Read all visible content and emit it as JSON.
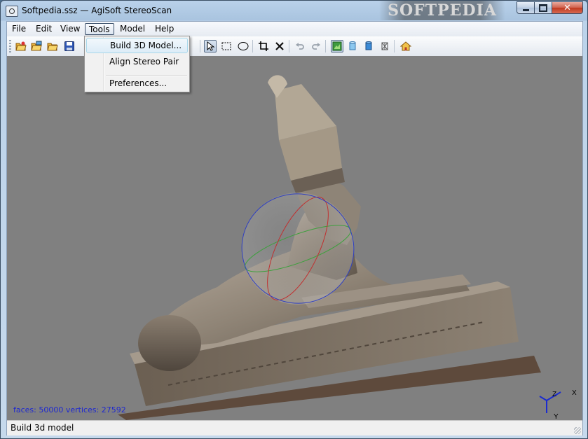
{
  "window": {
    "title": "Softpedia.ssz — AgiSoft StereoScan",
    "watermark": "SOFTPEDIA"
  },
  "menu": {
    "items": [
      {
        "label": "File"
      },
      {
        "label": "Edit"
      },
      {
        "label": "View"
      },
      {
        "label": "Tools",
        "active": true
      },
      {
        "label": "Model"
      },
      {
        "label": "Help"
      }
    ]
  },
  "tools_menu": {
    "items": [
      {
        "label": "Build 3D Model...",
        "highlighted": true
      },
      {
        "label": "Align Stereo Pair"
      },
      {
        "label": "Preferences..."
      }
    ]
  },
  "toolbar": {
    "buttons": [
      {
        "icon": "open-project-icon"
      },
      {
        "icon": "open-images-icon"
      },
      {
        "icon": "open-folder-icon"
      },
      {
        "icon": "save-icon"
      },
      {
        "icon": "select-pointer-icon",
        "pressed": true
      },
      {
        "icon": "rectangle-selection-icon"
      },
      {
        "icon": "ellipse-selection-icon"
      },
      {
        "icon": "crop-icon"
      },
      {
        "icon": "delete-icon"
      },
      {
        "icon": "undo-icon"
      },
      {
        "icon": "redo-icon"
      },
      {
        "icon": "textured-view-icon",
        "pressed": true
      },
      {
        "icon": "solid-view-icon"
      },
      {
        "icon": "shaded-view-icon"
      },
      {
        "icon": "wireframe-view-icon"
      },
      {
        "icon": "home-view-icon"
      }
    ]
  },
  "viewport": {
    "stats": "faces: 50000 vertices: 27592",
    "axes": {
      "z": "Z",
      "x": "X",
      "y": "Y"
    },
    "background_color": "#808080"
  },
  "status": {
    "text": "Build 3d model"
  }
}
